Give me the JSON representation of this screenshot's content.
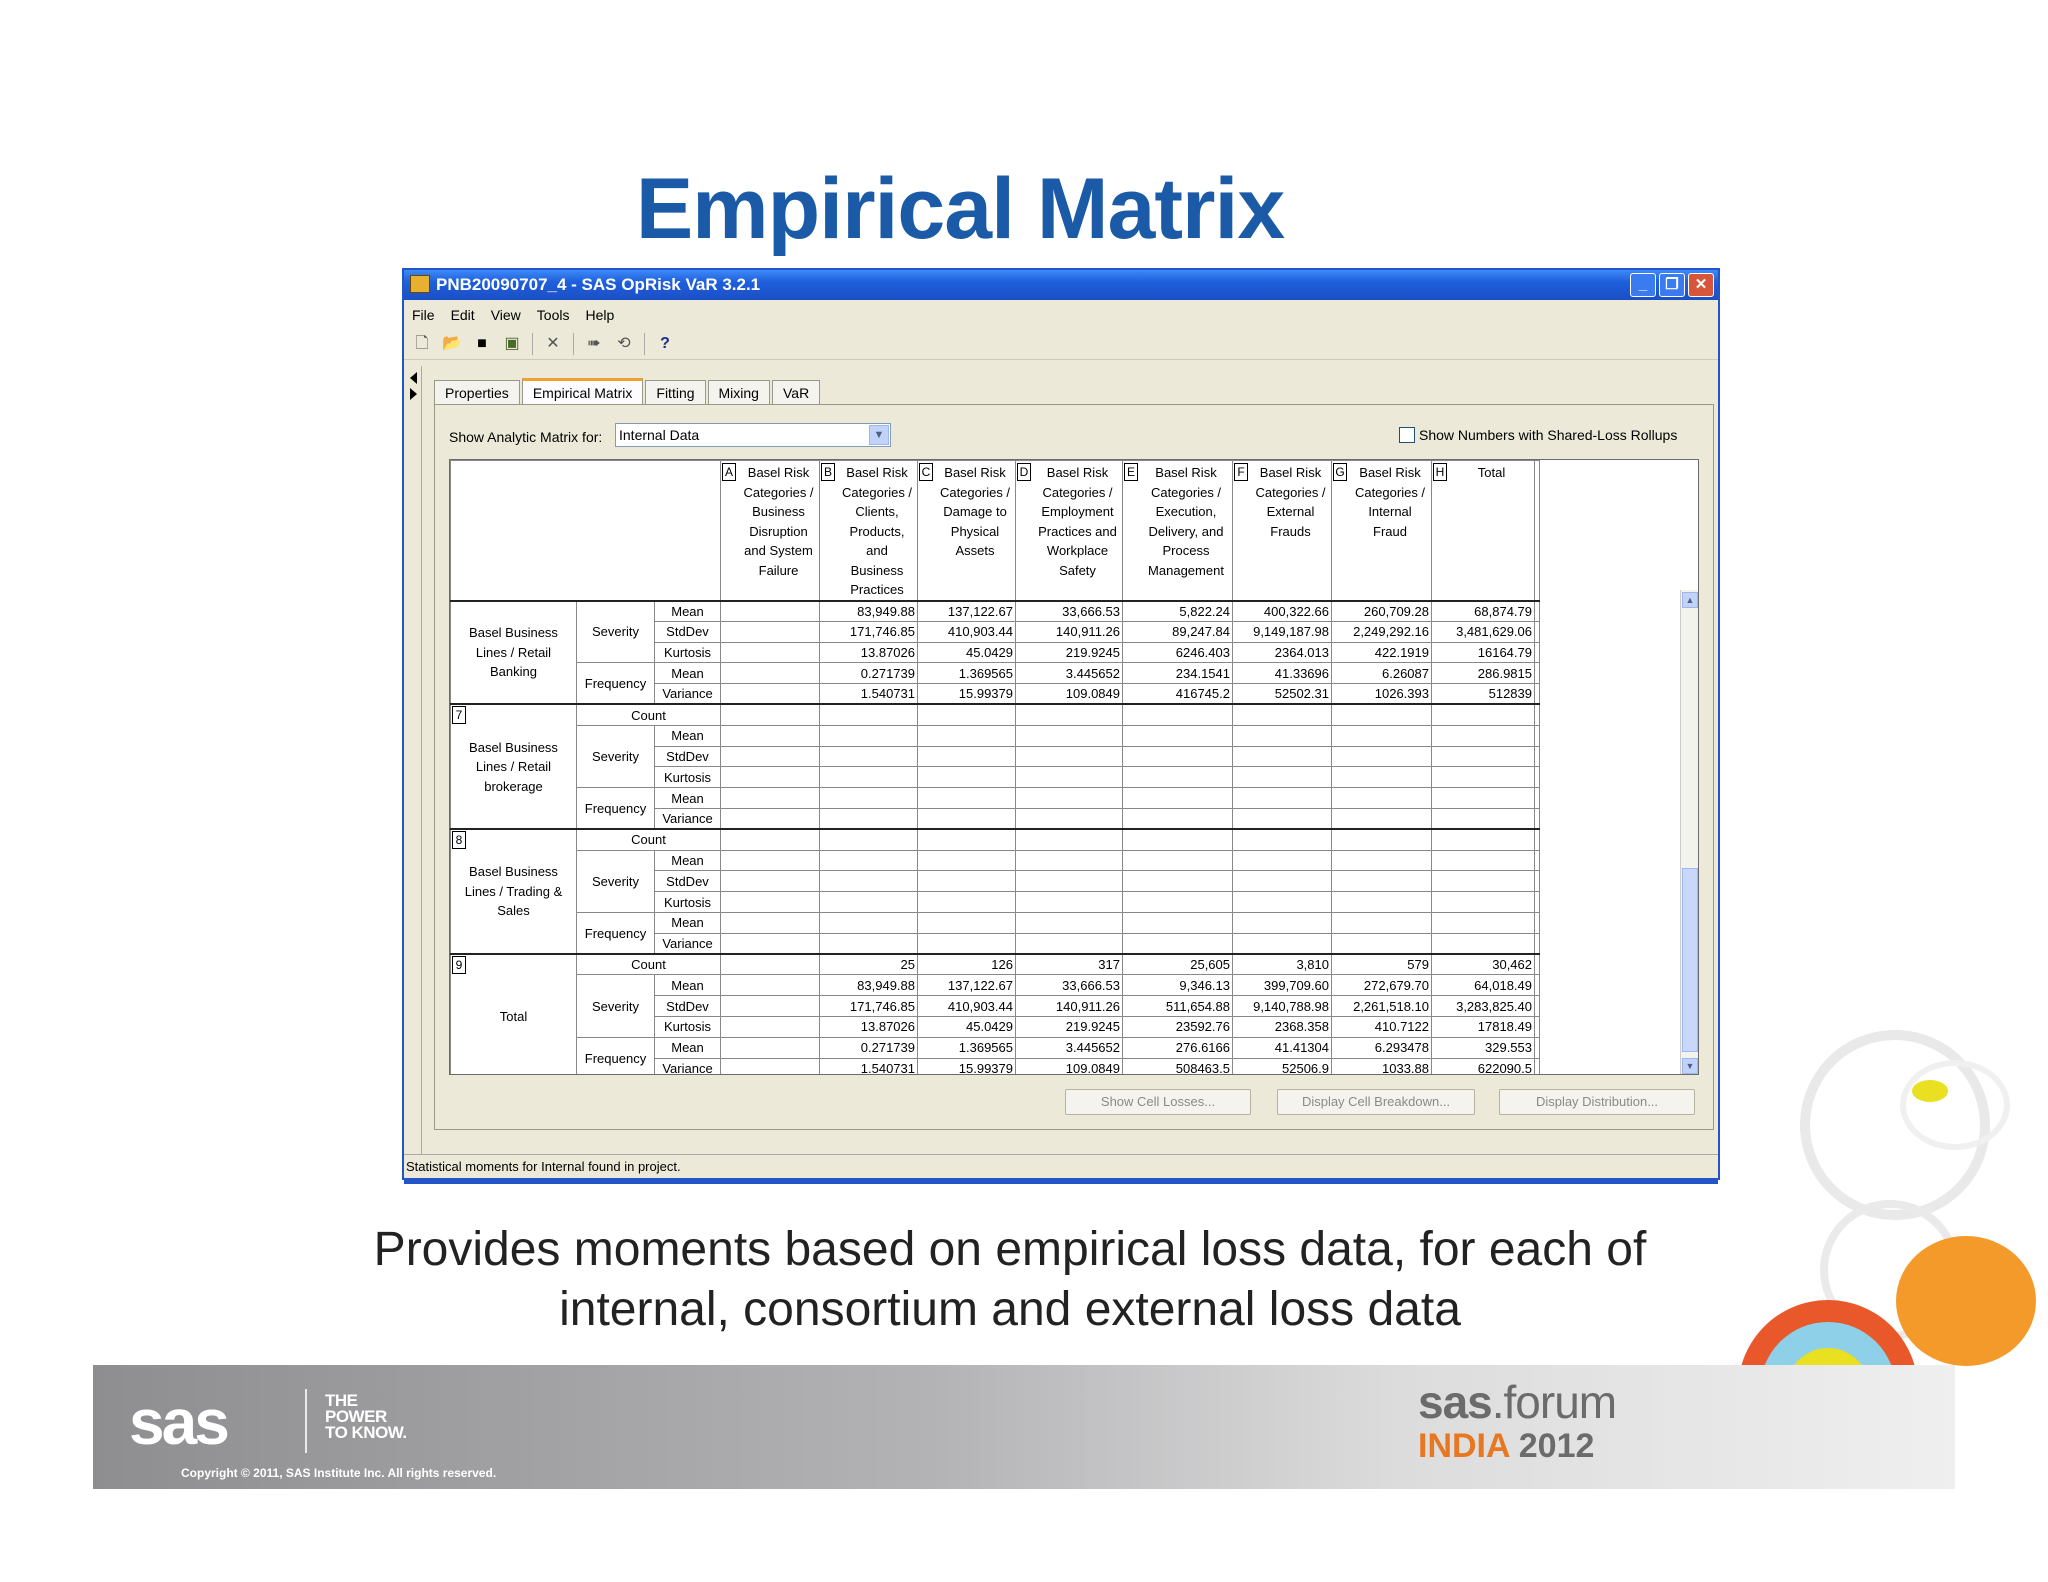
{
  "slide": {
    "title": "Empirical Matrix",
    "caption_line1": "Provides moments based on empirical loss data, for each of",
    "caption_line2": "internal, consortium and external loss data"
  },
  "window": {
    "title": "PNB20090707_4 - SAS OpRisk VaR 3.2.1",
    "menu": [
      "File",
      "Edit",
      "View",
      "Tools",
      "Help"
    ],
    "tabs": [
      "Properties",
      "Empirical Matrix",
      "Fitting",
      "Mixing",
      "VaR"
    ],
    "active_tab": "Empirical Matrix",
    "show_label": "Show Analytic Matrix for:",
    "show_value": "Internal Data",
    "checkbox_label": "Show Numbers with Shared-Loss Rollups",
    "buttons": {
      "show_cell_losses": "Show Cell Losses...",
      "display_cell_breakdown": "Display Cell Breakdown...",
      "display_distribution": "Display Distribution..."
    },
    "status": "Statistical moments for Internal found in project."
  },
  "matrix": {
    "columns": [
      {
        "letter": "A",
        "label": "Basel Risk Categories / Business Disruption and System Failure"
      },
      {
        "letter": "B",
        "label": "Basel Risk Categories / Clients, Products, and Business Practices"
      },
      {
        "letter": "C",
        "label": "Basel Risk Categories / Damage to Physical Assets"
      },
      {
        "letter": "D",
        "label": "Basel Risk Categories / Employment Practices and Workplace Safety"
      },
      {
        "letter": "E",
        "label": "Basel Risk Categories / Execution, Delivery, and Process Management"
      },
      {
        "letter": "F",
        "label": "Basel Risk Categories / External Frauds"
      },
      {
        "letter": "G",
        "label": "Basel Risk Categories / Internal Fraud"
      },
      {
        "letter": "H",
        "label": "Total"
      }
    ],
    "groups": [
      {
        "num": "",
        "label": "Basel Business Lines / Retail Banking",
        "rows": [
          {
            "cat": "Severity",
            "stat": "Mean",
            "values": [
              "",
              "83,949.88",
              "137,122.67",
              "33,666.53",
              "5,822.24",
              "400,322.66",
              "260,709.28",
              "68,874.79"
            ]
          },
          {
            "cat": "",
            "stat": "StdDev",
            "values": [
              "",
              "171,746.85",
              "410,903.44",
              "140,911.26",
              "89,247.84",
              "9,149,187.98",
              "2,249,292.16",
              "3,481,629.06"
            ]
          },
          {
            "cat": "",
            "stat": "Kurtosis",
            "values": [
              "",
              "13.87026",
              "45.0429",
              "219.9245",
              "6246.403",
              "2364.013",
              "422.1919",
              "16164.79"
            ]
          },
          {
            "cat": "Frequency",
            "stat": "Mean",
            "values": [
              "",
              "0.271739",
              "1.369565",
              "3.445652",
              "234.1541",
              "41.33696",
              "6.26087",
              "286.9815"
            ]
          },
          {
            "cat": "",
            "stat": "Variance",
            "values": [
              "",
              "1.540731",
              "15.99379",
              "109.0849",
              "416745.2",
              "52502.31",
              "1026.393",
              "512839"
            ]
          }
        ]
      },
      {
        "num": "7",
        "label": "Basel Business Lines / Retail brokerage",
        "count": [
          "",
          "",
          "",
          "",
          "",
          "",
          "",
          ""
        ],
        "rows": [
          {
            "cat": "Severity",
            "stat": "Mean",
            "values": [
              "",
              "",
              "",
              "",
              "",
              "",
              "",
              ""
            ]
          },
          {
            "cat": "",
            "stat": "StdDev",
            "values": [
              "",
              "",
              "",
              "",
              "",
              "",
              "",
              ""
            ]
          },
          {
            "cat": "",
            "stat": "Kurtosis",
            "values": [
              "",
              "",
              "",
              "",
              "",
              "",
              "",
              ""
            ]
          },
          {
            "cat": "Frequency",
            "stat": "Mean",
            "values": [
              "",
              "",
              "",
              "",
              "",
              "",
              "",
              ""
            ]
          },
          {
            "cat": "",
            "stat": "Variance",
            "values": [
              "",
              "",
              "",
              "",
              "",
              "",
              "",
              ""
            ]
          }
        ]
      },
      {
        "num": "8",
        "label": "Basel Business Lines / Trading & Sales",
        "count": [
          "",
          "",
          "",
          "",
          "",
          "",
          "",
          ""
        ],
        "rows": [
          {
            "cat": "Severity",
            "stat": "Mean",
            "values": [
              "",
              "",
              "",
              "",
              "",
              "",
              "",
              ""
            ]
          },
          {
            "cat": "",
            "stat": "StdDev",
            "values": [
              "",
              "",
              "",
              "",
              "",
              "",
              "",
              ""
            ]
          },
          {
            "cat": "",
            "stat": "Kurtosis",
            "values": [
              "",
              "",
              "",
              "",
              "",
              "",
              "",
              ""
            ]
          },
          {
            "cat": "Frequency",
            "stat": "Mean",
            "values": [
              "",
              "",
              "",
              "",
              "",
              "",
              "",
              ""
            ]
          },
          {
            "cat": "",
            "stat": "Variance",
            "values": [
              "",
              "",
              "",
              "",
              "",
              "",
              "",
              ""
            ]
          }
        ]
      },
      {
        "num": "9",
        "label": "Total",
        "count": [
          "",
          "25",
          "126",
          "317",
          "25,605",
          "3,810",
          "579",
          "30,462"
        ],
        "rows": [
          {
            "cat": "Severity",
            "stat": "Mean",
            "values": [
              "",
              "83,949.88",
              "137,122.67",
              "33,666.53",
              "9,346.13",
              "399,709.60",
              "272,679.70",
              "64,018.49"
            ]
          },
          {
            "cat": "",
            "stat": "StdDev",
            "values": [
              "",
              "171,746.85",
              "410,903.44",
              "140,911.26",
              "511,654.88",
              "9,140,788.98",
              "2,261,518.10",
              "3,283,825.40"
            ]
          },
          {
            "cat": "",
            "stat": "Kurtosis",
            "values": [
              "",
              "13.87026",
              "45.0429",
              "219.9245",
              "23592.76",
              "2368.358",
              "410.7122",
              "17818.49"
            ]
          },
          {
            "cat": "Frequency",
            "stat": "Mean",
            "values": [
              "",
              "0.271739",
              "1.369565",
              "3.445652",
              "276.6166",
              "41.41304",
              "6.293478",
              "329.553"
            ]
          },
          {
            "cat": "",
            "stat": "Variance",
            "values": [
              "",
              "1.540731",
              "15.99379",
              "109.0849",
              "508463.5",
              "52506.9",
              "1033.88",
              "622090.5"
            ]
          }
        ]
      }
    ],
    "count_label": "Count"
  },
  "footer": {
    "logo": "sas",
    "tagline": [
      "THE",
      "POWER",
      "TO KNOW."
    ],
    "copyright": "Copyright © 2011, SAS Institute Inc. All rights reserved.",
    "forum_brand": "sas",
    "forum_word": "forum",
    "event": "INDIA",
    "year": "2012"
  }
}
